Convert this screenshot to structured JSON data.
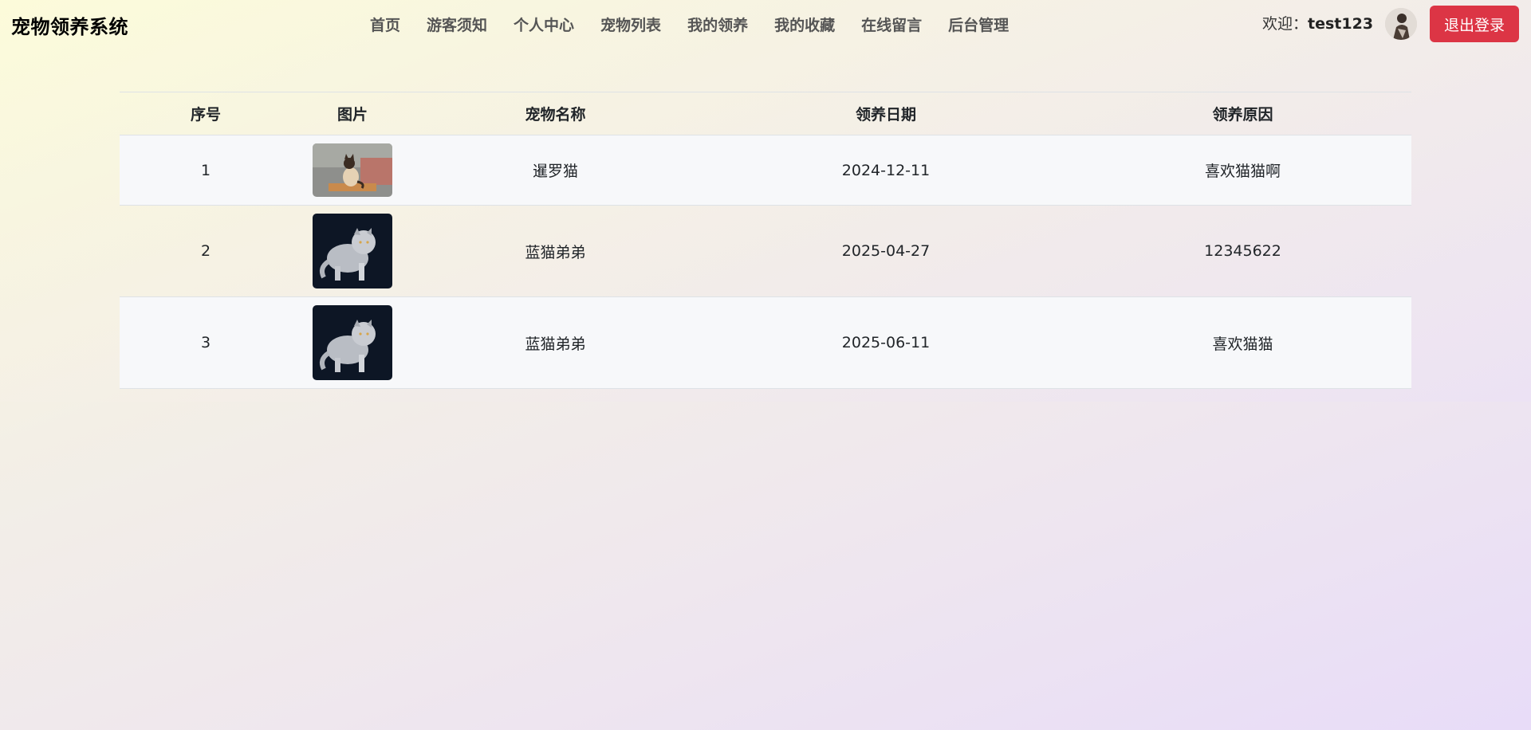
{
  "brand": "宠物领养系统",
  "nav": {
    "items": [
      "首页",
      "游客须知",
      "个人中心",
      "宠物列表",
      "我的领养",
      "我的收藏",
      "在线留言",
      "后台管理"
    ]
  },
  "user": {
    "welcome_label": "欢迎：",
    "username": "test123",
    "logout_label": "退出登录"
  },
  "table": {
    "headers": [
      "序号",
      "图片",
      "宠物名称",
      "领养日期",
      "领养原因"
    ],
    "rows": [
      {
        "index": "1",
        "image": "siamese-cat-photo",
        "name": "暹罗猫",
        "date": "2024-12-11",
        "reason": "喜欢猫猫啊"
      },
      {
        "index": "2",
        "image": "blue-cat-photo",
        "name": "蓝猫弟弟",
        "date": "2025-04-27",
        "reason": "12345622"
      },
      {
        "index": "3",
        "image": "blue-cat-photo",
        "name": "蓝猫弟弟",
        "date": "2025-06-11",
        "reason": "喜欢猫猫"
      }
    ]
  },
  "colors": {
    "logout_bg": "#dc3545",
    "row_stripe": "#f7f8fa"
  }
}
